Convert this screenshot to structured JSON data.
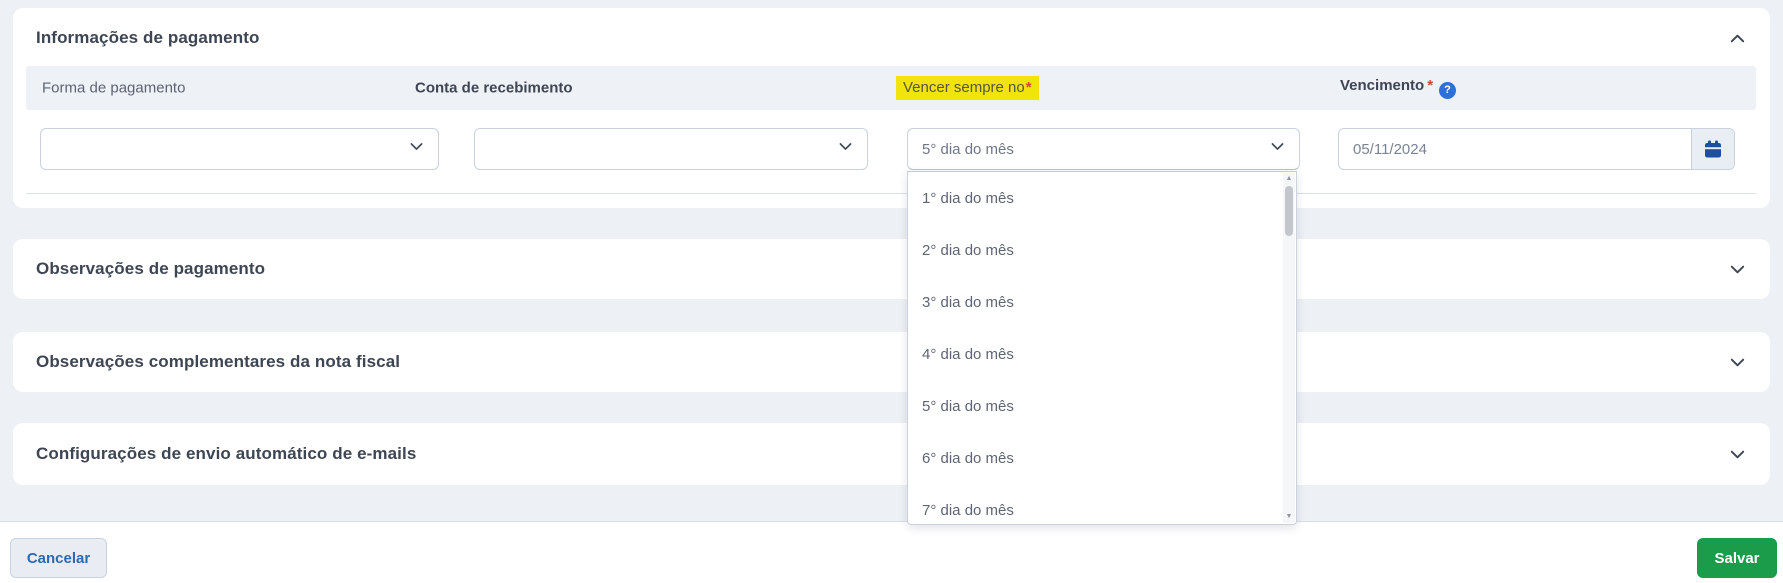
{
  "colors": {
    "page_bg": "#edf0f5",
    "card_bg": "#ffffff",
    "label_row_bg": "#eef1f6",
    "highlight_yellow": "#f0e40c",
    "required_red": "#cf4436",
    "help_blue": "#2e70d9",
    "calendar_blue": "#1d4f9e",
    "save_green": "#1a9c4b",
    "cancel_text_blue": "#2d68b3"
  },
  "payment_info": {
    "title": "Informações de pagamento",
    "required_marker": "*",
    "help_glyph": "?",
    "fields": {
      "payment_method": {
        "label": "Forma de pagamento",
        "value": ""
      },
      "receiving_account": {
        "label": "Conta de recebimento",
        "value": ""
      },
      "due_day": {
        "label": "Vencer sempre no",
        "selected": "5° dia do mês",
        "options": [
          "1° dia do mês",
          "2° dia do mês",
          "3° dia do mês",
          "4° dia do mês",
          "5° dia do mês",
          "6° dia do mês",
          "7° dia do mês"
        ]
      },
      "due_date": {
        "label": "Vencimento",
        "value": "05/11/2024"
      }
    }
  },
  "collapsed_sections": [
    {
      "title": "Observações de pagamento"
    },
    {
      "title": "Observações complementares da nota fiscal"
    },
    {
      "title": "Configurações de envio automático de e-mails"
    }
  ],
  "footer": {
    "cancel": "Cancelar",
    "save": "Salvar"
  }
}
